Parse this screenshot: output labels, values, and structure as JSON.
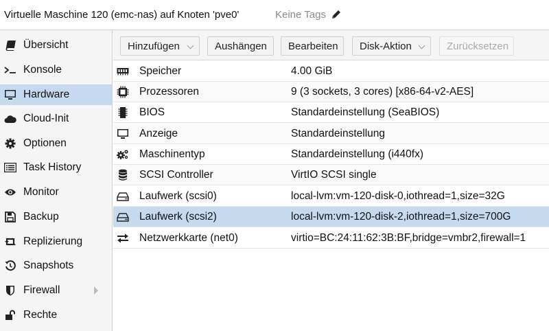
{
  "header": {
    "title": "Virtuelle Maschine 120 (emc-nas) auf Knoten 'pve0'",
    "tags": "Keine Tags",
    "tag_edit_icon": "pencil-icon"
  },
  "sidebar": {
    "items": [
      {
        "label": "Übersicht",
        "icon": "book-icon"
      },
      {
        "label": "Konsole",
        "icon": "terminal-icon"
      },
      {
        "label": "Hardware",
        "icon": "monitor-icon",
        "active": true
      },
      {
        "label": "Cloud-Init",
        "icon": "cloud-icon"
      },
      {
        "label": "Optionen",
        "icon": "gear-icon"
      },
      {
        "label": "Task History",
        "icon": "list-icon"
      },
      {
        "label": "Monitor",
        "icon": "eye-icon"
      },
      {
        "label": "Backup",
        "icon": "floppy-icon"
      },
      {
        "label": "Replizierung",
        "icon": "retweet-icon"
      },
      {
        "label": "Snapshots",
        "icon": "history-icon"
      },
      {
        "label": "Firewall",
        "icon": "shield-icon",
        "expandable": true
      },
      {
        "label": "Rechte",
        "icon": "unlock-icon"
      }
    ]
  },
  "toolbar": {
    "add": "Hinzufügen",
    "detach": "Aushängen",
    "edit": "Bearbeiten",
    "disk_action": "Disk-Aktion",
    "reset": "Zurücksetzen"
  },
  "hardware": [
    {
      "key": "Speicher",
      "value": "4.00 GiB",
      "icon": "memory-icon"
    },
    {
      "key": "Prozessoren",
      "value": "9 (3 sockets, 3 cores) [x86-64-v2-AES]",
      "icon": "cpu-icon"
    },
    {
      "key": "BIOS",
      "value": "Standardeinstellung (SeaBIOS)",
      "icon": "microchip-icon"
    },
    {
      "key": "Anzeige",
      "value": "Standardeinstellung",
      "icon": "desktop-icon"
    },
    {
      "key": "Maschinentyp",
      "value": "Standardeinstellung (i440fx)",
      "icon": "cogs-icon"
    },
    {
      "key": "SCSI Controller",
      "value": "VirtIO SCSI single",
      "icon": "database-icon"
    },
    {
      "key": "Laufwerk (scsi0)",
      "value": "local-lvm:vm-120-disk-0,iothread=1,size=32G",
      "icon": "hdd-icon"
    },
    {
      "key": "Laufwerk (scsi2)",
      "value": "local-lvm:vm-120-disk-2,iothread=1,size=700G",
      "icon": "hdd-icon",
      "selected": true
    },
    {
      "key": "Netzwerkkarte (net0)",
      "value": "virtio=BC:24:11:62:3B:BF,bridge=vmbr2,firewall=1",
      "icon": "exchange-icon"
    }
  ]
}
